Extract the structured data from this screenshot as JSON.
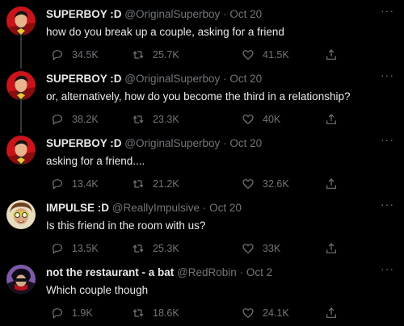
{
  "tweets": [
    {
      "name": "SUPERBOY :D",
      "handle": "@OriginalSuperboy",
      "dot": "·",
      "time": "Oct 20",
      "text": "how do you break up a couple, asking for a friend",
      "replies": "34.5K",
      "retweets": "25.7K",
      "likes": "41.5K",
      "avatar": "superboy-avatar"
    },
    {
      "name": "SUPERBOY :D",
      "handle": "@OriginalSuperboy",
      "dot": "·",
      "time": "Oct 20",
      "text": "or, alternatively, how do you become the third in a relationship?",
      "replies": "38.2K",
      "retweets": "23.3K",
      "likes": "40K",
      "avatar": "superboy-avatar"
    },
    {
      "name": "SUPERBOY :D",
      "handle": "@OriginalSuperboy",
      "dot": "·",
      "time": "Oct 20",
      "text": "asking for a friend....",
      "replies": "13.4K",
      "retweets": "21.2K",
      "likes": "32.6K",
      "avatar": "superboy-avatar"
    },
    {
      "name": "IMPULSE :D",
      "handle": "@ReallyImpulsive",
      "dot": "·",
      "time": "Oct 20",
      "text": "Is this friend in the room with us?",
      "replies": "13.5K",
      "retweets": "25.3K",
      "likes": "33K",
      "avatar": "impulse-avatar"
    },
    {
      "name": "not the restaurant - a bat",
      "handle": "@RedRobin",
      "dot": "·",
      "time": "Oct 2",
      "text": "Which couple though",
      "replies": "1.9K",
      "retweets": "18.6K",
      "likes": "24.1K",
      "avatar": "redrobin-avatar"
    }
  ],
  "more_label": "···",
  "colors": {
    "background": "#000000",
    "primary_text": "#e7e9ea",
    "secondary_text": "#71767b",
    "thread_line": "#333639"
  }
}
